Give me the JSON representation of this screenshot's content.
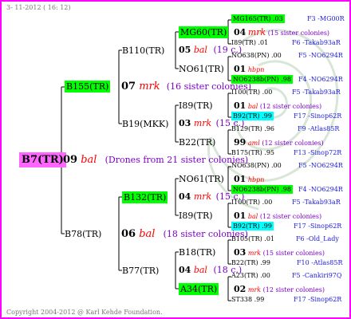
{
  "header": {
    "date": "3- 11-2012 ( 16: 12)"
  },
  "footer": {
    "copyright": "Copyright 2004-2012 @ Karl Kehde Foundation."
  },
  "root": {
    "id": "B7(TR)",
    "year": "09",
    "breed": "bal",
    "note": "(Drones from 21 sister colonies)"
  },
  "gen2": {
    "upper": {
      "id": "B155(TR)",
      "year": "07",
      "breed": "mrk",
      "note": "(16 sister colonies)"
    },
    "lower": {
      "id": "B78(TR)",
      "year": "06",
      "breed": "bal",
      "note": "(18 sister colonies)"
    }
  },
  "gen3": {
    "a": {
      "id": "B110(TR)",
      "year": "05",
      "breed": "bal",
      "note": "(19 c.)"
    },
    "b": {
      "id": "B19(MKK)",
      "year": "03",
      "breed": "mrk",
      "note": "(15 c.)"
    },
    "c": {
      "id": "B132(TR)",
      "year": "04",
      "breed": "mrk",
      "note": "(15 c.)"
    },
    "d": {
      "id": "B77(TR)",
      "year": "04",
      "breed": "bal",
      "note": "(18 c.)"
    }
  },
  "gen4": {
    "a1": {
      "id": "MG60(TR)"
    },
    "a2": {
      "id": "NO61(TR)"
    },
    "b1": {
      "id": "I89(TR)"
    },
    "b2": {
      "id": "B22(TR)"
    },
    "c1": {
      "id": "NO61(TR)"
    },
    "c2": {
      "id": "I89(TR)"
    },
    "d1": {
      "id": "B18(TR)"
    },
    "d2": {
      "id": "A34(TR)"
    }
  },
  "gen5": [
    {
      "left": "MG165(TR) .03",
      "right": "F3 -MG00R"
    },
    {
      "year": "04",
      "breed": "mrk",
      "note": "(15 sister colonies)"
    },
    {
      "left": "I89(TR) .01",
      "right": "F6 -Takab93aR"
    },
    {
      "left": "NO638(PN) .00",
      "right": "F5 -NO6294R"
    },
    {
      "year": "01",
      "breed": "hbpn",
      "note": ""
    },
    {
      "left": "NO6238b(PN) .98",
      "right": "F4 -NO6294R"
    },
    {
      "left": "I100(TR) .00",
      "right": "F5 -Takab93aR"
    },
    {
      "year": "01",
      "breed": "bal",
      "note": "(12 sister colonies)"
    },
    {
      "left": "B92(TR) .99",
      "right": "F17 -Sinop62R"
    },
    {
      "left": "B129(TR) .96",
      "right": "F9 -Atlas85R"
    },
    {
      "year": "99",
      "breed": "aml",
      "note": "(12 sister colonies)"
    },
    {
      "left": "B175(TR) .95",
      "right": "F13 -Sinop72R"
    },
    {
      "left": "NO638(PN) .00",
      "right": "F5 -NO6294R"
    },
    {
      "year": "01",
      "breed": "hbpn",
      "note": ""
    },
    {
      "left": "NO6238b(PN) .98",
      "right": "F4 -NO6294R"
    },
    {
      "left": "I100(TR) .00",
      "right": "F5 -Takab93aR"
    },
    {
      "year": "01",
      "breed": "bal",
      "note": "(12 sister colonies)"
    },
    {
      "left": "B92(TR) .99",
      "right": "F17 -Sinop62R"
    },
    {
      "left": "B105(TR) .01",
      "right": "F6 -Old_Lady"
    },
    {
      "year": "03",
      "breed": "mrk",
      "note": "(15 sister colonies)"
    },
    {
      "left": "B22(TR) .99",
      "right": "F10 -Atlas85R"
    },
    {
      "left": "A23(TR) .00",
      "right": "F5 -Cankiri97Q"
    },
    {
      "year": "02",
      "breed": "mrk",
      "note": "(12 sister colonies)"
    },
    {
      "left": "ST338 .99",
      "right": "F17 -Sinop62R"
    }
  ]
}
